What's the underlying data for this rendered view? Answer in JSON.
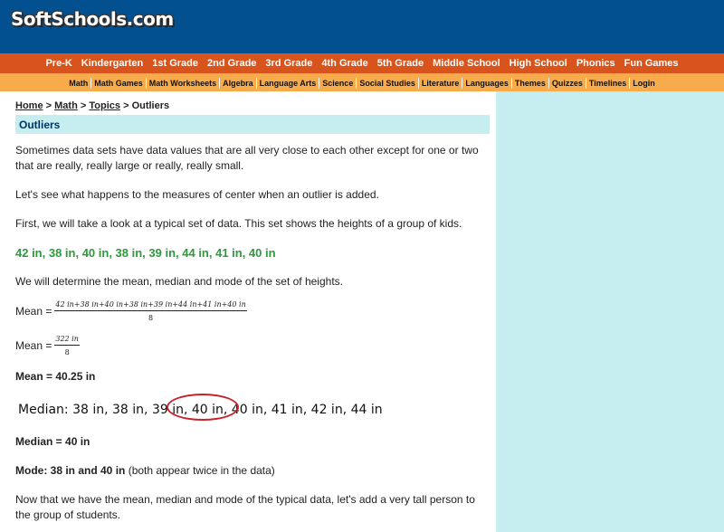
{
  "header": {
    "logo_text": "SoftSchools.com"
  },
  "nav_primary": [
    "Pre-K",
    "Kindergarten",
    "1st Grade",
    "2nd Grade",
    "3rd Grade",
    "4th Grade",
    "5th Grade",
    "Middle School",
    "High School",
    "Phonics",
    "Fun Games"
  ],
  "nav_secondary": [
    "Math",
    "Math Games",
    "Math Worksheets",
    "Algebra",
    "Language Arts",
    "Science",
    "Social Studies",
    "Literature",
    "Languages",
    "Themes",
    "Quizzes",
    "Timelines",
    "Login"
  ],
  "breadcrumb": {
    "home": "Home",
    "math": "Math",
    "topics": "Topics",
    "sep": ">",
    "current": "Outliers"
  },
  "page_title": "Outliers",
  "paragraphs": {
    "p1": "Sometimes data sets have data values that are all very close to each other except for one or two that are really, really large or really, really small.",
    "p2": "Let's see what happens to the measures of center when an outlier is added.",
    "p3": "First, we will take a look at a typical set of data. This set shows the heights of a group of kids.",
    "data_set": "42 in, 38 in, 40 in, 38 in, 39 in, 44 in, 41 in, 40 in",
    "p4": "We will determine the mean, median and mode of the set of heights.",
    "mean_label": "Mean =",
    "mean_num1": "42 in+38 in+40 in+38 in+39 in+44 in+41 in+40 in",
    "mean_den1": "8",
    "mean_num2": "322 in",
    "mean_den2": "8",
    "mean_result": "Mean = 40.25 in",
    "median_before": "Median: 38 in, 38 in, 39 in,",
    "median_circled": " 40 in, 40 in,",
    "median_after": " 41 in, 42 in, 44 in",
    "median_result": "Median = 40 in",
    "mode_bold": "Mode: 38 in and 40 in",
    "mode_rest": " (both appear twice in the data)",
    "p5": "Now that we have the mean, median and mode of the typical data, let's add a very tall person to the group of students."
  }
}
